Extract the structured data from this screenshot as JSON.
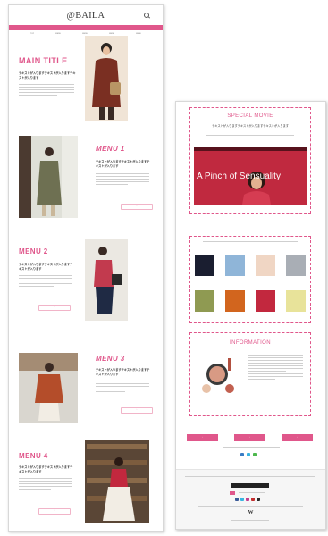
{
  "left": {
    "logo": "@BAILA",
    "subnav": [
      "TOP",
      "MENU",
      "MENU",
      "MENU",
      "MENU"
    ],
    "sections": [
      {
        "title": "MAIN TITLE",
        "lead": "テキストが入りますテキストが入りますテキストが入ります"
      },
      {
        "title": "MENU 1",
        "lead": "テキストが入りますテキストが入りますテキストが入ります"
      },
      {
        "title": "MENU 2",
        "lead": "テキストが入りますテキストが入りますテキストが入ります"
      },
      {
        "title": "MENU 3",
        "lead": "テキストが入りますテキストが入りますテキストが入ります"
      },
      {
        "title": "MENU 4",
        "lead": "テキストが入りますテキストが入りますテキストが入ります"
      }
    ]
  },
  "right": {
    "special_movie": {
      "title": "SPECIAL MOVIE",
      "lead": "テキストが入りますテキストが入りますテキストが入ります",
      "video_title": "A Pinch of Sensuality"
    },
    "information": {
      "title": "INFORMATION"
    },
    "footer": {
      "logo_mark": "W"
    }
  },
  "colors": {
    "accent": "#e0578b",
    "video_bg": "#c0293f"
  },
  "icons": [
    "search-icon",
    "play-icon",
    "social-icon"
  ]
}
